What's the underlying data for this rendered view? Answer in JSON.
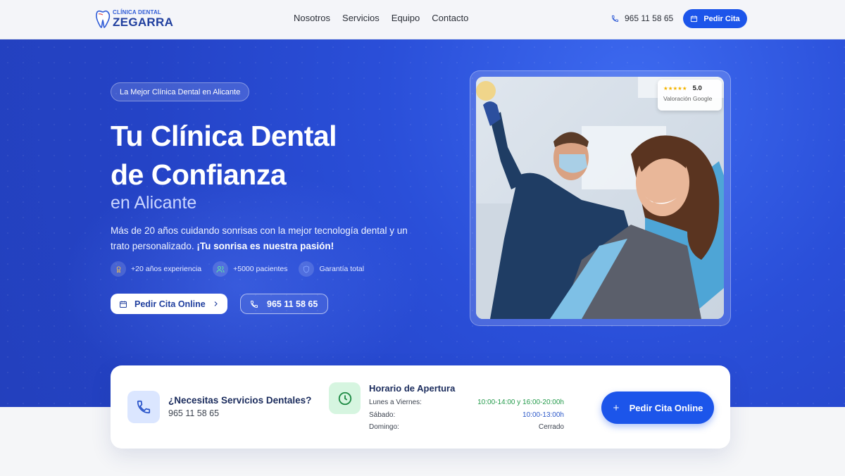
{
  "header": {
    "logo": {
      "small": "CLÍNICA DENTAL",
      "big": "ZEGARRA"
    },
    "nav": [
      "Nosotros",
      "Servicios",
      "Equipo",
      "Contacto"
    ],
    "phone": "965 11 58 65",
    "cta": "Pedir Cita"
  },
  "hero": {
    "badge": "La Mejor Clínica Dental en Alicante",
    "title_line1": "Tu Clínica Dental",
    "title_line2": "de Confianza",
    "subtitle": "en Alicante",
    "lead": "Más de 20 años cuidando sonrisas con la mejor tecnología dental y un trato personalizado.",
    "lead_strong": "¡Tu sonrisa es nuestra pasión!",
    "features": [
      {
        "icon": "award-icon",
        "label": "+20 años experiencia"
      },
      {
        "icon": "users-icon",
        "label": "+5000 pacientes"
      },
      {
        "icon": "shield-icon",
        "label": "Garantía total"
      }
    ],
    "primary_cta": "Pedir Cita Online",
    "secondary_cta": "965 11 58 65",
    "rating": {
      "score": "5.0",
      "label": "Valoración Google",
      "stars": 5
    }
  },
  "info": {
    "need_title": "¿Necesitas Servicios Dentales?",
    "need_phone": "965 11 58 65",
    "hours_title": "Horario de Apertura",
    "hours": [
      {
        "day": "Lunes a Viernes:",
        "time": "10:00-14:00 y 16:00-20:00h"
      },
      {
        "day": "Sábado:",
        "time": "10:00-13:00h"
      },
      {
        "day": "Domingo:",
        "time": "Cerrado"
      }
    ],
    "cta": "Pedir Cita Online"
  },
  "colors": {
    "primary": "#1c55ea",
    "navy": "#1a2b5c",
    "green": "#239a4a",
    "star": "#f3b400"
  }
}
